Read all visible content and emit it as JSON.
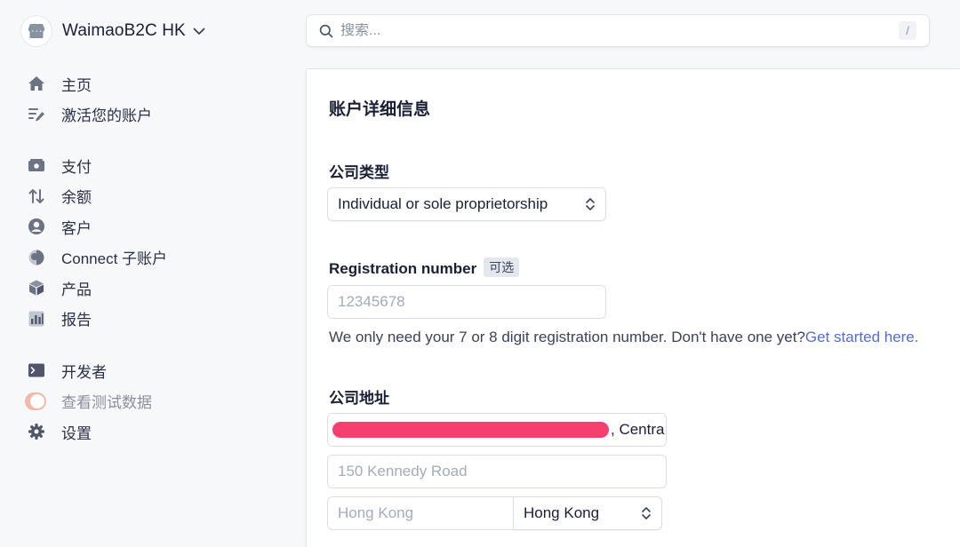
{
  "account": {
    "name": "WaimaoB2C HK"
  },
  "search": {
    "placeholder": "搜索...",
    "shortcut": "/"
  },
  "sidebar": {
    "items": [
      {
        "label": "主页",
        "icon": "home-icon"
      },
      {
        "label": "激活您的账户",
        "icon": "checklist-edit-icon"
      },
      {
        "label": "支付",
        "icon": "payments-icon"
      },
      {
        "label": "余额",
        "icon": "balance-arrows-icon"
      },
      {
        "label": "客户",
        "icon": "customer-icon"
      },
      {
        "label": "Connect 子账户",
        "icon": "connect-icon"
      },
      {
        "label": "产品",
        "icon": "product-box-icon"
      },
      {
        "label": "报告",
        "icon": "reports-icon"
      },
      {
        "label": "开发者",
        "icon": "terminal-icon"
      },
      {
        "label": "查看测试数据",
        "icon": "toggle-switch",
        "toggle_on": true
      },
      {
        "label": "设置",
        "icon": "gear-icon"
      }
    ]
  },
  "form": {
    "title": "账户详细信息",
    "company_type": {
      "label": "公司类型",
      "value": "Individual or sole proprietorship"
    },
    "registration": {
      "label": "Registration number",
      "optional": "可选",
      "placeholder": "12345678",
      "help": "We only need your 7 or 8 digit registration number. Don't have one yet?",
      "help_link": "Get started here."
    },
    "address": {
      "label": "公司地址",
      "line1_visible": ", Centra",
      "line2_placeholder": "150 Kennedy Road",
      "city_placeholder": "Hong Kong",
      "region_value": "Hong Kong"
    }
  },
  "colors": {
    "accent": "#556cd6",
    "toggle": "#f4b8a8",
    "redaction": "#f43f6f",
    "background": "#f6f8fa"
  }
}
